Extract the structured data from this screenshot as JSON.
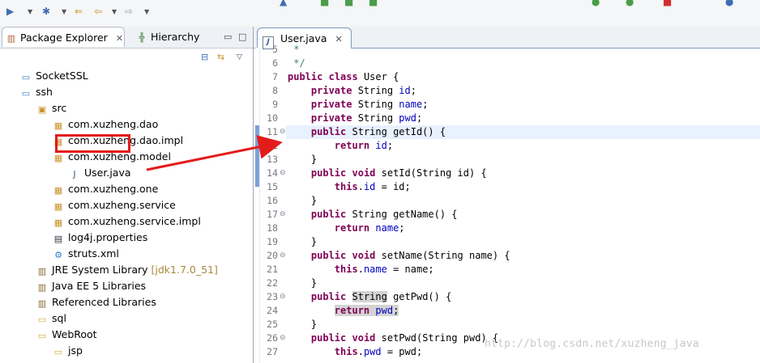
{
  "toolbar": {
    "icons": [
      "run-icon",
      "dropdown",
      "debug-icon",
      "dropdown",
      "back-icon",
      "forward-icon",
      "dropdown",
      "forward-icon",
      "dropdown"
    ]
  },
  "left_panel": {
    "tabs": [
      {
        "label": "Package Explorer",
        "active": true
      },
      {
        "label": "Hierarchy",
        "active": false
      }
    ],
    "tree": [
      {
        "label": "SocketSSL",
        "icon": "project-icon",
        "indent": 0
      },
      {
        "label": "ssh",
        "icon": "project-icon",
        "indent": 0
      },
      {
        "label": "src",
        "icon": "source-folder-icon",
        "indent": 1
      },
      {
        "label": "com.xuzheng.dao",
        "icon": "package-icon",
        "indent": 2
      },
      {
        "label": "com.xuzheng.dao.impl",
        "icon": "package-icon",
        "indent": 2
      },
      {
        "label": "com.xuzheng.model",
        "icon": "package-icon",
        "indent": 2
      },
      {
        "label": "User.java",
        "icon": "java-file-icon",
        "indent": 3
      },
      {
        "label": "com.xuzheng.one",
        "icon": "package-icon",
        "indent": 2
      },
      {
        "label": "com.xuzheng.service",
        "icon": "package-icon",
        "indent": 2
      },
      {
        "label": "com.xuzheng.service.impl",
        "icon": "package-icon",
        "indent": 2
      },
      {
        "label": "log4j.properties",
        "icon": "properties-file-icon",
        "indent": 2
      },
      {
        "label": "struts.xml",
        "icon": "xml-file-icon",
        "indent": 2
      },
      {
        "label": "JRE System Library",
        "decoration": "[jdk1.7.0_51]",
        "icon": "library-icon",
        "indent": 1
      },
      {
        "label": "Java EE 5 Libraries",
        "icon": "library-icon",
        "indent": 1
      },
      {
        "label": "Referenced Libraries",
        "icon": "library-icon",
        "indent": 1
      },
      {
        "label": "sql",
        "icon": "folder-icon",
        "indent": 1
      },
      {
        "label": "WebRoot",
        "icon": "folder-icon",
        "indent": 1
      },
      {
        "label": "jsp",
        "icon": "folder-icon",
        "indent": 2
      }
    ]
  },
  "editor": {
    "tab_label": "User.java",
    "lines": [
      {
        "n": "5",
        "text": " *"
      },
      {
        "n": "6",
        "text": " */"
      },
      {
        "n": "7",
        "text": "public class User {"
      },
      {
        "n": "8",
        "text": "    private String id;"
      },
      {
        "n": "9",
        "text": "    private String name;"
      },
      {
        "n": "10",
        "text": "    private String pwd;"
      },
      {
        "n": "11",
        "text": "    public String getId() {"
      },
      {
        "n": "12",
        "text": "        return id;"
      },
      {
        "n": "13",
        "text": "    }"
      },
      {
        "n": "14",
        "text": "    public void setId(String id) {"
      },
      {
        "n": "15",
        "text": "        this.id = id;"
      },
      {
        "n": "16",
        "text": "    }"
      },
      {
        "n": "17",
        "text": "    public String getName() {"
      },
      {
        "n": "18",
        "text": "        return name;"
      },
      {
        "n": "19",
        "text": "    }"
      },
      {
        "n": "20",
        "text": "    public void setName(String name) {"
      },
      {
        "n": "21",
        "text": "        this.name = name;"
      },
      {
        "n": "22",
        "text": "    }"
      },
      {
        "n": "23",
        "text": "    public String getPwd() {"
      },
      {
        "n": "24",
        "text": "        return pwd;"
      },
      {
        "n": "25",
        "text": "    }"
      },
      {
        "n": "26",
        "text": "    public void setPwd(String pwd) {"
      },
      {
        "n": "27",
        "text": "        this.pwd = pwd;"
      }
    ]
  },
  "watermark": "http://blog.csdn.net/xuzheng_java",
  "colors": {
    "keyword": "#7f0055",
    "field": "#0000c0",
    "annotation": "#e31b1b",
    "current_line": "#e8f2fe"
  }
}
